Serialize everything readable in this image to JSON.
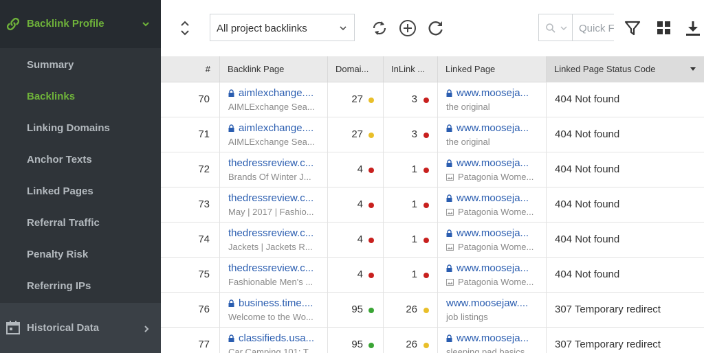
{
  "sidebar": {
    "section_title": "Backlink Profile",
    "items": [
      {
        "label": "Summary",
        "active": false
      },
      {
        "label": "Backlinks",
        "active": true
      },
      {
        "label": "Linking Domains",
        "active": false
      },
      {
        "label": "Anchor Texts",
        "active": false
      },
      {
        "label": "Linked Pages",
        "active": false
      },
      {
        "label": "Referral Traffic",
        "active": false
      },
      {
        "label": "Penalty Risk",
        "active": false
      },
      {
        "label": "Referring IPs",
        "active": false
      }
    ],
    "historical": {
      "label": "Historical Data"
    }
  },
  "toolbar": {
    "filter_select": "All project backlinks",
    "search_placeholder": "Quick F"
  },
  "table": {
    "columns": [
      "#",
      "Backlink Page",
      "Domai...",
      "InLink ...",
      "Linked Page",
      "Linked Page Status Code"
    ],
    "rows": [
      {
        "num": "70",
        "bl_link": "aimlexchange....",
        "bl_sub": "AIMLExchange Sea...",
        "bl_lock": true,
        "domain": "27",
        "domain_dot": "yellow",
        "inlink": "3",
        "inlink_dot": "red",
        "lp_link": "www.mooseja...",
        "lp_sub": "the original",
        "lp_lock": true,
        "lp_img": false,
        "status": "404 Not found"
      },
      {
        "num": "71",
        "bl_link": "aimlexchange....",
        "bl_sub": "AIMLExchange Sea...",
        "bl_lock": true,
        "domain": "27",
        "domain_dot": "yellow",
        "inlink": "3",
        "inlink_dot": "red",
        "lp_link": "www.mooseja...",
        "lp_sub": "the original",
        "lp_lock": true,
        "lp_img": false,
        "status": "404 Not found"
      },
      {
        "num": "72",
        "bl_link": "thedressreview.c...",
        "bl_sub": "Brands Of Winter J...",
        "bl_lock": false,
        "domain": "4",
        "domain_dot": "red",
        "inlink": "1",
        "inlink_dot": "red",
        "lp_link": "www.mooseja...",
        "lp_sub": "Patagonia Wome...",
        "lp_lock": true,
        "lp_img": true,
        "status": "404 Not found"
      },
      {
        "num": "73",
        "bl_link": "thedressreview.c...",
        "bl_sub": "May | 2017 | Fashio...",
        "bl_lock": false,
        "domain": "4",
        "domain_dot": "red",
        "inlink": "1",
        "inlink_dot": "red",
        "lp_link": "www.mooseja...",
        "lp_sub": "Patagonia Wome...",
        "lp_lock": true,
        "lp_img": true,
        "status": "404 Not found"
      },
      {
        "num": "74",
        "bl_link": "thedressreview.c...",
        "bl_sub": "Jackets | Jackets R...",
        "bl_lock": false,
        "domain": "4",
        "domain_dot": "red",
        "inlink": "1",
        "inlink_dot": "red",
        "lp_link": "www.mooseja...",
        "lp_sub": "Patagonia Wome...",
        "lp_lock": true,
        "lp_img": true,
        "status": "404 Not found"
      },
      {
        "num": "75",
        "bl_link": "thedressreview.c...",
        "bl_sub": "Fashionable Men's ...",
        "bl_lock": false,
        "domain": "4",
        "domain_dot": "red",
        "inlink": "1",
        "inlink_dot": "red",
        "lp_link": "www.mooseja...",
        "lp_sub": "Patagonia Wome...",
        "lp_lock": true,
        "lp_img": true,
        "status": "404 Not found"
      },
      {
        "num": "76",
        "bl_link": "business.time....",
        "bl_sub": "Welcome to the Wo...",
        "bl_lock": true,
        "domain": "95",
        "domain_dot": "green",
        "inlink": "26",
        "inlink_dot": "yellow",
        "lp_link": "www.moosejaw....",
        "lp_sub": "job listings",
        "lp_lock": false,
        "lp_img": false,
        "status": "307 Temporary redirect"
      },
      {
        "num": "77",
        "bl_link": "classifieds.usa...",
        "bl_sub": "Car Camping 101: T...",
        "bl_lock": true,
        "domain": "95",
        "domain_dot": "green",
        "inlink": "26",
        "inlink_dot": "yellow",
        "lp_link": "www.mooseja...",
        "lp_sub": "sleeping pad basics",
        "lp_lock": true,
        "lp_img": false,
        "status": "307 Temporary redirect"
      }
    ]
  },
  "colors": {
    "accent_green": "#6fb33a",
    "link_blue": "#2a5db0",
    "dot_red": "#c8201e",
    "dot_yellow": "#e9bf2a",
    "dot_green": "#3aa535"
  }
}
